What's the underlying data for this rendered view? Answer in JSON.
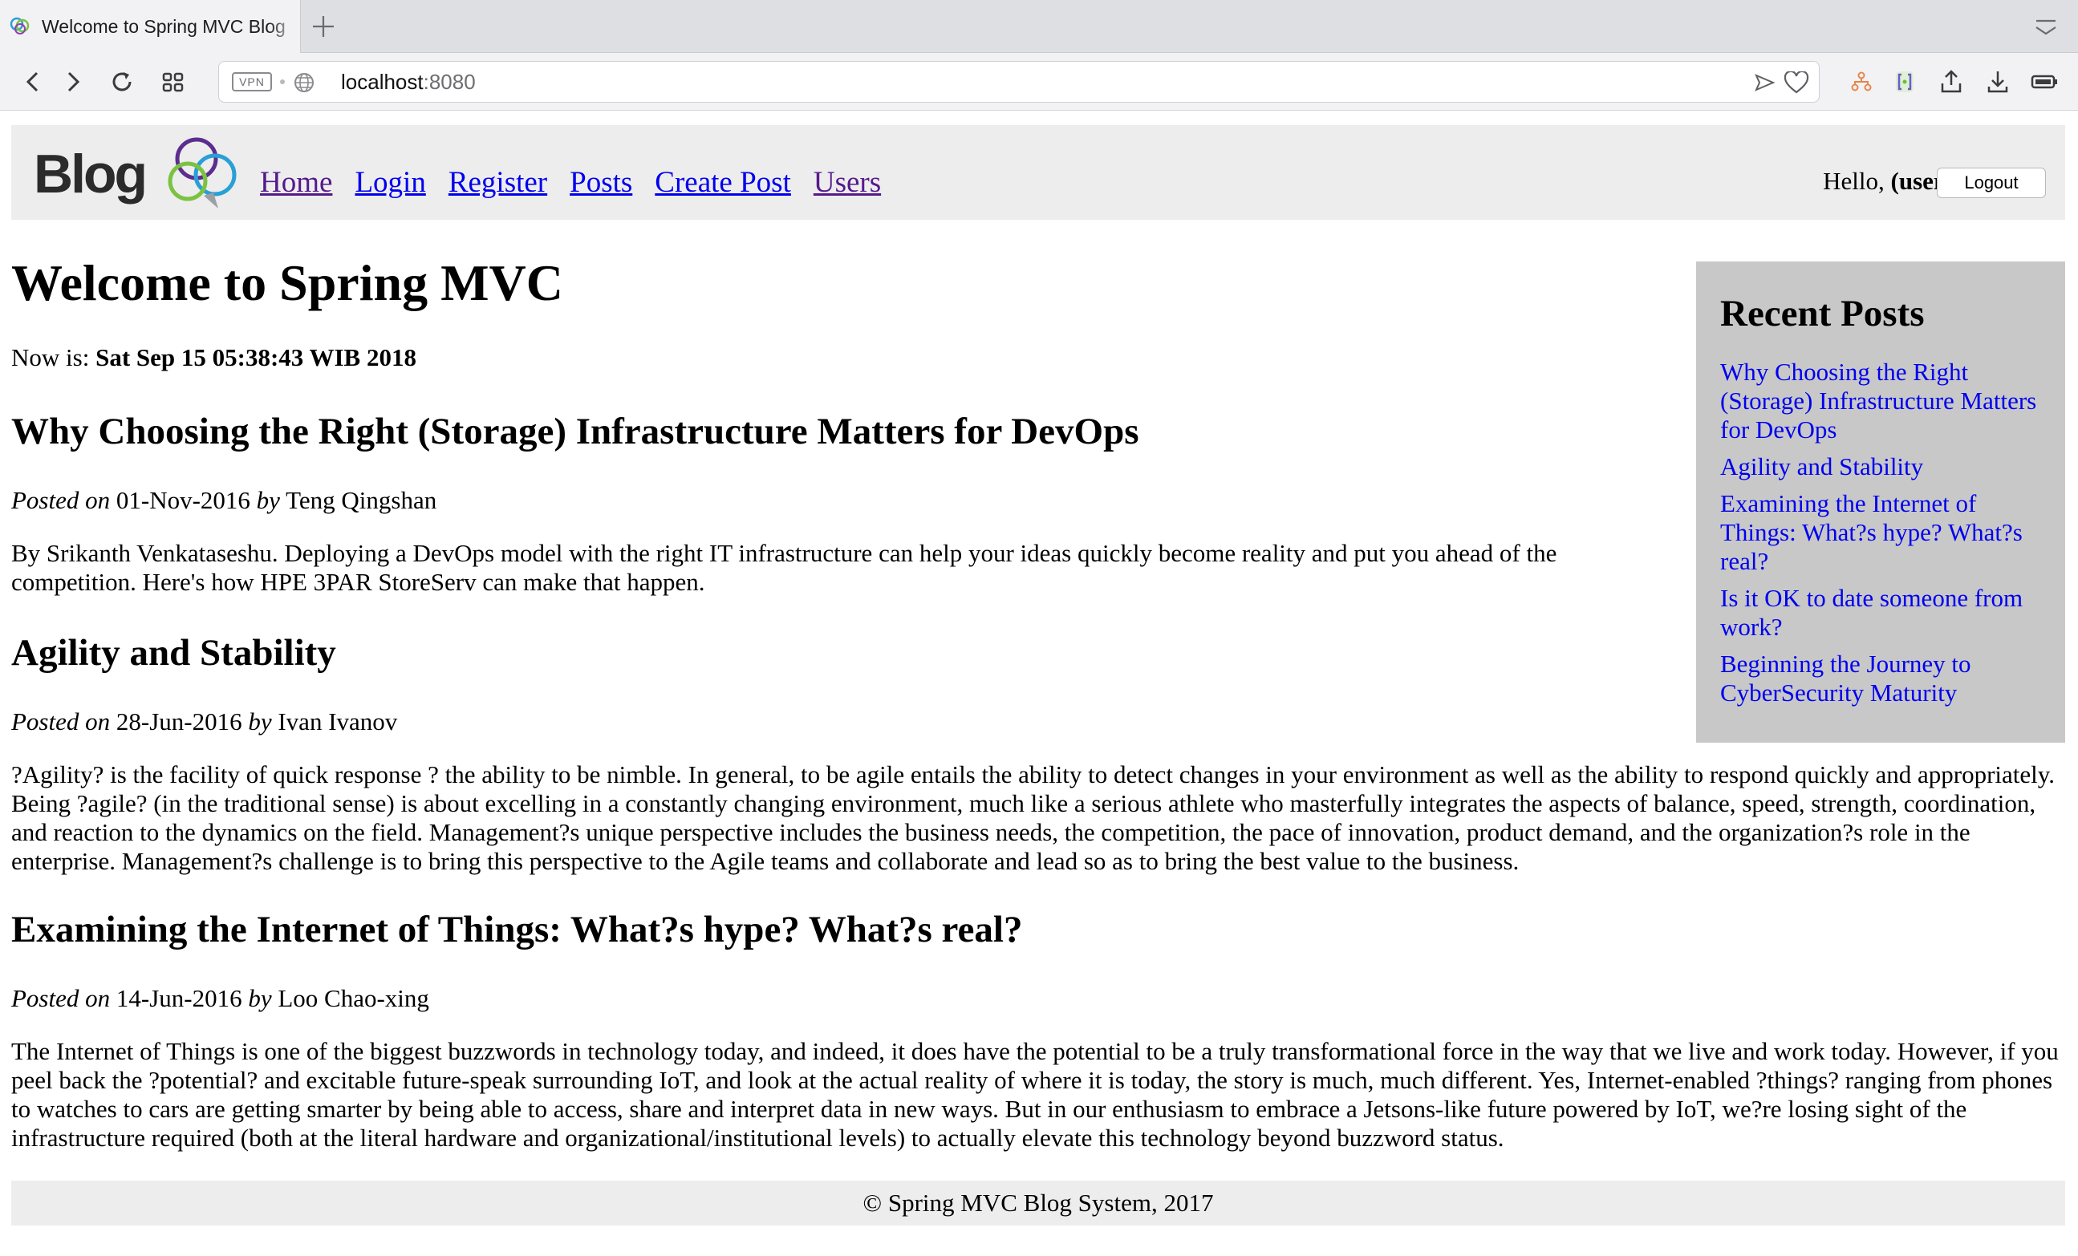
{
  "browser": {
    "tab_title": "Welcome to Spring MVC Blog",
    "vpn_label": "VPN",
    "url_host": "localhost",
    "url_port": ":8080"
  },
  "header": {
    "logo_text": "Blog",
    "nav": [
      {
        "label": "Home"
      },
      {
        "label": "Login"
      },
      {
        "label": "Register"
      },
      {
        "label": "Posts"
      },
      {
        "label": "Create Post"
      },
      {
        "label": "Users"
      }
    ],
    "hello_prefix": "Hello, ",
    "hello_user": "(user)",
    "logout_label": "Logout"
  },
  "main": {
    "title": "Welcome to Spring MVC",
    "now_prefix": "Now is: ",
    "now_value": "Sat Sep 15 05:38:43 WIB 2018",
    "posts": [
      {
        "title": "Why Choosing the Right (Storage) Infrastructure Matters for DevOps",
        "posted_on_label": "Posted on",
        "date": "01-Nov-2016",
        "by_label": "by",
        "author": "Teng Qingshan",
        "body": "By Srikanth Venkataseshu. Deploying a DevOps model with the right IT infrastructure can help your ideas quickly become reality and put you ahead of the competition. Here's how HPE 3PAR StoreServ can make that happen."
      },
      {
        "title": "Agility and Stability",
        "posted_on_label": "Posted on",
        "date": "28-Jun-2016",
        "by_label": "by",
        "author": "Ivan Ivanov",
        "body": "?Agility? is the facility of quick response ? the ability to be nimble. In general, to be agile entails the ability to detect changes in your environment as well as the ability to respond quickly and appropriately. Being ?agile? (in the traditional sense) is about excelling in a constantly changing environment, much like a serious athlete who masterfully integrates the aspects of balance, speed, strength, coordination, and reaction to the dynamics on the field. Management?s unique perspective includes the business needs, the competition, the pace of innovation, product demand, and the organization?s role in the enterprise. Management?s challenge is to bring this perspective to the Agile teams and collaborate and lead so as to bring the best value to the business."
      },
      {
        "title": "Examining the Internet of Things: What?s hype? What?s real?",
        "posted_on_label": "Posted on",
        "date": "14-Jun-2016",
        "by_label": "by",
        "author": "Loo Chao-xing",
        "body": "The Internet of Things is one of the biggest buzzwords in technology today, and indeed, it does have the potential to be a truly transformational force in the way that we live and work today. However, if you peel back the ?potential? and excitable future-speak surrounding IoT, and look at the actual reality of where it is today, the story is much, much different. Yes, Internet-enabled ?things? ranging from phones to watches to cars are getting smarter by being able to access, share and interpret data in new ways. But in our enthusiasm to embrace a Jetsons-like future powered by IoT, we?re losing sight of the infrastructure required (both at the literal hardware and organizational/institutional levels) to actually elevate this technology beyond buzzword status."
      }
    ]
  },
  "sidebar": {
    "title": "Recent Posts",
    "items": [
      {
        "label": "Why Choosing the Right (Storage) Infrastructure Matters for DevOps"
      },
      {
        "label": "Agility and Stability"
      },
      {
        "label": "Examining the Internet of Things: What?s hype? What?s real?"
      },
      {
        "label": "Is it OK to date someone from work?"
      },
      {
        "label": "Beginning the Journey to CyberSecurity Maturity"
      }
    ]
  },
  "footer": {
    "text": "© Spring MVC Blog System, 2017"
  },
  "colors": {
    "link": "#0000ee",
    "visited_link": "#551a8b",
    "header_bg": "#ededed",
    "sidebar_bg": "#c8c8c8"
  }
}
